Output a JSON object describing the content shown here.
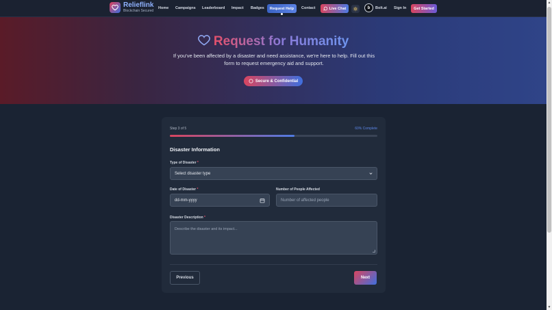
{
  "brand": {
    "name": "Relieflink",
    "tagline": "Blockchain Secured"
  },
  "nav": {
    "links": [
      "Home",
      "Campaigns",
      "Leaderboard",
      "Impact",
      "Badges"
    ],
    "active": "Request Help",
    "contact": "Contact",
    "live_chat": "Live Chat",
    "bolt_badge": "b",
    "bolt_label": "Bolt.ai",
    "sign_in": "Sign In",
    "get_started": "Get Started"
  },
  "hero": {
    "title": "Request for Humanity",
    "subtitle": "If you've been affected by a disaster and need assistance, we're here to help. Fill out this form to request emergency aid and support.",
    "badge": "Secure & Confidential"
  },
  "form": {
    "step_label": "Step 3 of 5",
    "percent_label": "60% Complete",
    "progress": 0.6,
    "section_title": "Disaster Information",
    "disaster_type_label": "Type of Disaster",
    "disaster_type_value": "Select disaster type",
    "date_label": "Date of Disaster",
    "date_placeholder": "dd-mm-yyyy",
    "people_label": "Number of People Affected",
    "people_placeholder": "Number of affected people",
    "description_label": "Disaster Description",
    "description_placeholder": "Describe the disaster and its impact...",
    "required_mark": "*",
    "prev_button": "Previous",
    "next_button": "Next"
  },
  "colors": {
    "accent_red": "#d9455f",
    "accent_blue": "#4f7be3",
    "background": "#1a2333",
    "card": "#212b3b"
  },
  "icons": [
    "heart-icon",
    "chat-icon",
    "sun-icon",
    "shield-icon",
    "chevron-down-icon",
    "calendar-icon"
  ]
}
